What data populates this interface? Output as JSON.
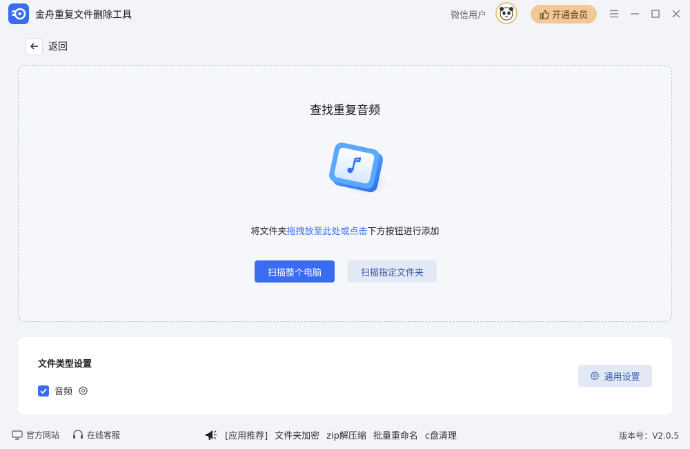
{
  "app": {
    "title": "金舟重复文件删除工具"
  },
  "header": {
    "user_name": "微信用户",
    "vip_label": "开通会员"
  },
  "nav": {
    "back_label": "返回"
  },
  "dropzone": {
    "title": "查找重复音频",
    "hint_prefix": "将文件夹",
    "hint_link": "拖拽放至此处或点击",
    "hint_suffix": "下方按钮进行添加",
    "scan_all_label": "扫描整个电脑",
    "scan_folder_label": "扫描指定文件夹"
  },
  "settings": {
    "title": "文件类型设置",
    "file_type_label": "音频",
    "file_type_checked": true,
    "general_settings_label": "通用设置"
  },
  "footer": {
    "official_site": "官方网站",
    "online_service": "在线客服",
    "recommend_label": "[应用推荐]",
    "recommend_links": [
      "文件夹加密",
      "zip解压缩",
      "批量重命名",
      "c盘清理"
    ],
    "version": "版本号：V2.0.5"
  },
  "colors": {
    "accent": "#3a6cf0",
    "vip": "#f0c996",
    "background": "#f3f4f8"
  }
}
